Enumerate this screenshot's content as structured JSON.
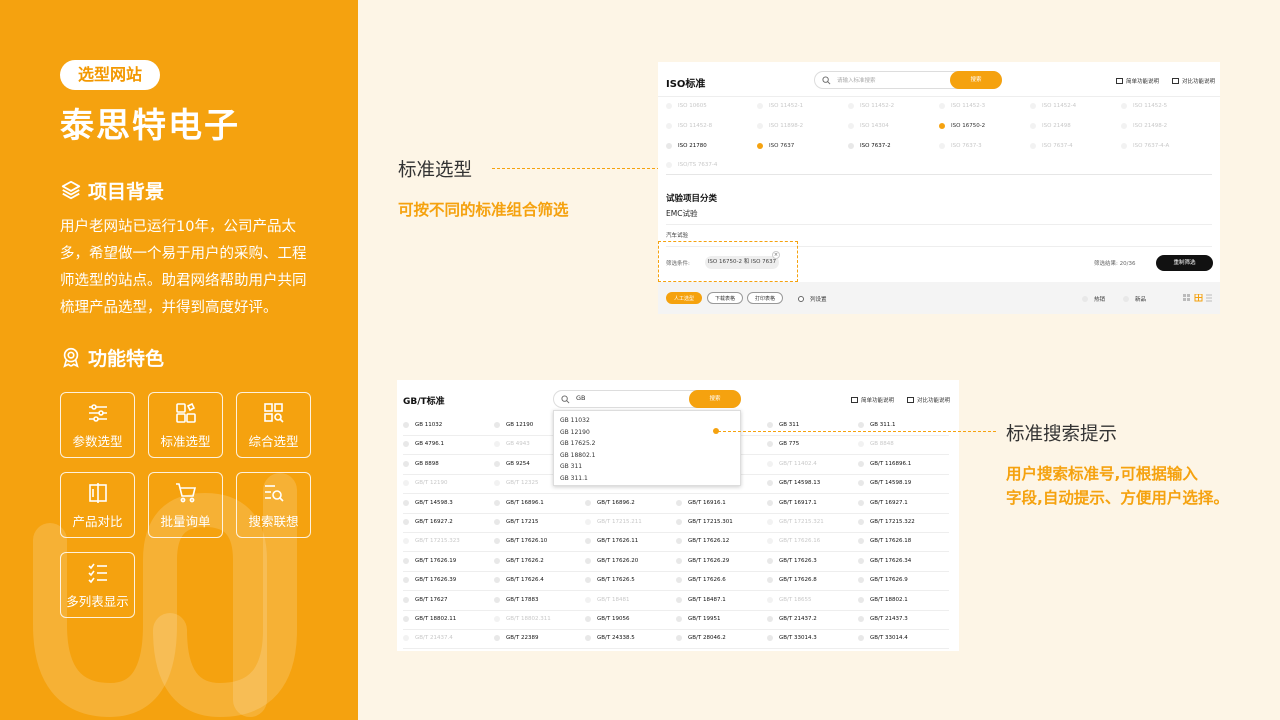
{
  "left": {
    "tag": "选型网站",
    "client": "泰思特电子",
    "background_title": "项目背景",
    "background_text": "用户老网站已运行10年，公司产品太多，希望做一个易于用户的采购、工程师选型的站点。助君网络帮助用户共同梳理产品选型，并得到高度好评。",
    "features_title": "功能特色",
    "features": [
      {
        "label": "参数选型",
        "icon": "sliders-icon"
      },
      {
        "label": "标准选型",
        "icon": "blocks-icon"
      },
      {
        "label": "综合选型",
        "icon": "grid-search-icon"
      },
      {
        "label": "产品对比",
        "icon": "compare-icon"
      },
      {
        "label": "批量询单",
        "icon": "cart-icon"
      },
      {
        "label": "搜索联想",
        "icon": "list-search-icon"
      },
      {
        "label": "多列表显示",
        "icon": "checklist-icon"
      }
    ],
    "colors": {
      "accent": "#f5a20f",
      "page_bg": "#fdf5e6"
    }
  },
  "annotations": {
    "a1_title": "标准选型",
    "a1_sub": "可按不同的标准组合筛选",
    "a2_title": "标准搜索提示",
    "a2_sub_line1": "用户搜索标准号,可根据输入",
    "a2_sub_line2": "字段,自动提示、方便用户选择。"
  },
  "shot1": {
    "title": "ISO标准",
    "search_placeholder": "请输入标准搜索",
    "search_button": "搜索",
    "link_simple": "简单功能说明",
    "link_compare": "对比功能说明",
    "options": [
      [
        {
          "t": "ISO 10605",
          "s": "dim"
        },
        {
          "t": "ISO 11452-1",
          "s": "dim"
        },
        {
          "t": "ISO 11452-2",
          "s": "dim"
        },
        {
          "t": "ISO 11452-3",
          "s": "dim"
        },
        {
          "t": "ISO 11452-4",
          "s": "dim"
        },
        {
          "t": "ISO 11452-5",
          "s": "dim"
        }
      ],
      [
        {
          "t": "ISO 11452-8",
          "s": "dim"
        },
        {
          "t": "ISO 11898-2",
          "s": "dim"
        },
        {
          "t": "ISO 14304",
          "s": "dim"
        },
        {
          "t": "ISO 16750-2",
          "s": "sel"
        },
        {
          "t": "ISO 21498",
          "s": "dim"
        },
        {
          "t": "ISO 21498-2",
          "s": "dim"
        }
      ],
      [
        {
          "t": "ISO 21780",
          "s": "bold"
        },
        {
          "t": "ISO 7637",
          "s": "sel"
        },
        {
          "t": "ISO 7637-2",
          "s": "bold"
        },
        {
          "t": "ISO 7637-3",
          "s": "dim"
        },
        {
          "t": "ISO 7637-4",
          "s": "dim"
        },
        {
          "t": "ISO 7637-4-A",
          "s": "dim"
        }
      ]
    ],
    "extra_option": "ISO/TS 7637-4",
    "category_title": "试验项目分类",
    "category_item": "EMC试验",
    "sub_item": "汽车试验",
    "filter_label": "筛选条件:",
    "filter_value": "ISO 16750-2 和 ISO 7637",
    "filter_close": "×",
    "result_label": "筛选结果: 20/36",
    "reset_button": "重制筛选",
    "btn_manual": "人工选型",
    "btn_download": "下载表格",
    "btn_print": "打印表格",
    "btn_cols": "列设置",
    "radio_hot": "热销",
    "radio_new": "新品"
  },
  "shot2": {
    "title": "GB/T标准",
    "search_value": "GB",
    "search_button": "搜索",
    "link_simple": "简单功能说明",
    "link_compare": "对比功能说明",
    "suggestions": [
      "GB 11032",
      "GB 12190",
      "GB 17625.2",
      "GB 18802.1",
      "GB 311",
      "GB 311.1"
    ],
    "rows": [
      [
        {
          "t": "GB 11032",
          "s": "bold"
        },
        {
          "t": "GB 12190",
          "s": "bold"
        },
        {
          "t": "",
          "s": "hide"
        },
        {
          "t": "",
          "s": "hide"
        },
        {
          "t": "GB 311",
          "s": "bold"
        },
        {
          "t": "GB 311.1",
          "s": "bold"
        }
      ],
      [
        {
          "t": "GB 4796.1",
          "s": "bold"
        },
        {
          "t": "GB 4943",
          "s": "dim"
        },
        {
          "t": "",
          "s": "hide"
        },
        {
          "t": "",
          "s": "hide"
        },
        {
          "t": "GB 775",
          "s": "bold"
        },
        {
          "t": "GB 8848",
          "s": "dim"
        }
      ],
      [
        {
          "t": "GB 8898",
          "s": "bold"
        },
        {
          "t": "GB 9254",
          "s": "bold"
        },
        {
          "t": "",
          "s": "hide"
        },
        {
          "t": "",
          "s": "hide"
        },
        {
          "t": "GB/T 11402.4",
          "s": "dim"
        },
        {
          "t": "GB/T 116896.1",
          "s": "bold"
        }
      ],
      [
        {
          "t": "GB/T 12190",
          "s": "dim"
        },
        {
          "t": "GB/T 12325",
          "s": "dim"
        },
        {
          "t": "",
          "s": "hide"
        },
        {
          "t": "",
          "s": "hide"
        },
        {
          "t": "GB/T 14598.13",
          "s": "bold"
        },
        {
          "t": "GB/T 14598.19",
          "s": "bold"
        }
      ],
      [
        {
          "t": "GB/T 14598.3",
          "s": "bold"
        },
        {
          "t": "GB/T 16896.1",
          "s": "bold"
        },
        {
          "t": "GB/T 16896.2",
          "s": "bold"
        },
        {
          "t": "GB/T 16916.1",
          "s": "bold"
        },
        {
          "t": "GB/T 16917.1",
          "s": "bold"
        },
        {
          "t": "GB/T 16927.1",
          "s": "bold"
        }
      ],
      [
        {
          "t": "GB/T 16927.2",
          "s": "bold"
        },
        {
          "t": "GB/T 17215",
          "s": "bold"
        },
        {
          "t": "GB/T 17215.211",
          "s": "dim"
        },
        {
          "t": "GB/T 17215.301",
          "s": "bold"
        },
        {
          "t": "GB/T 17215.321",
          "s": "dim"
        },
        {
          "t": "GB/T 17215.322",
          "s": "bold"
        }
      ],
      [
        {
          "t": "GB/T 17215.323",
          "s": "dim"
        },
        {
          "t": "GB/T 17626.10",
          "s": "bold"
        },
        {
          "t": "GB/T 17626.11",
          "s": "bold"
        },
        {
          "t": "GB/T 17626.12",
          "s": "bold"
        },
        {
          "t": "GB/T 17626.16",
          "s": "dim"
        },
        {
          "t": "GB/T 17626.18",
          "s": "bold"
        }
      ],
      [
        {
          "t": "GB/T 17626.19",
          "s": "bold"
        },
        {
          "t": "GB/T 17626.2",
          "s": "bold"
        },
        {
          "t": "GB/T 17626.20",
          "s": "bold"
        },
        {
          "t": "GB/T 17626.29",
          "s": "bold"
        },
        {
          "t": "GB/T 17626.3",
          "s": "bold"
        },
        {
          "t": "GB/T 17626.34",
          "s": "bold"
        }
      ],
      [
        {
          "t": "GB/T 17626.39",
          "s": "bold"
        },
        {
          "t": "GB/T 17626.4",
          "s": "bold"
        },
        {
          "t": "GB/T 17626.5",
          "s": "bold"
        },
        {
          "t": "GB/T 17626.6",
          "s": "bold"
        },
        {
          "t": "GB/T 17626.8",
          "s": "bold"
        },
        {
          "t": "GB/T 17626.9",
          "s": "bold"
        }
      ],
      [
        {
          "t": "GB/T 17627",
          "s": "bold"
        },
        {
          "t": "GB/T 17883",
          "s": "bold"
        },
        {
          "t": "GB/T 18481",
          "s": "dim"
        },
        {
          "t": "GB/T 18487.1",
          "s": "bold"
        },
        {
          "t": "GB/T 18655",
          "s": "dim"
        },
        {
          "t": "GB/T 18802.1",
          "s": "bold"
        }
      ],
      [
        {
          "t": "GB/T 18802.11",
          "s": "bold"
        },
        {
          "t": "GB/T 18802.311",
          "s": "dim"
        },
        {
          "t": "GB/T 19056",
          "s": "bold"
        },
        {
          "t": "GB/T 19951",
          "s": "bold"
        },
        {
          "t": "GB/T 21437.2",
          "s": "bold"
        },
        {
          "t": "GB/T 21437.3",
          "s": "bold"
        }
      ],
      [
        {
          "t": "GB/T 21437.4",
          "s": "dim"
        },
        {
          "t": "GB/T 22389",
          "s": "bold"
        },
        {
          "t": "GB/T 24338.5",
          "s": "bold"
        },
        {
          "t": "GB/T 28046.2",
          "s": "bold"
        },
        {
          "t": "GB/T 33014.3",
          "s": "bold"
        },
        {
          "t": "GB/T 33014.4",
          "s": "bold"
        }
      ]
    ]
  }
}
